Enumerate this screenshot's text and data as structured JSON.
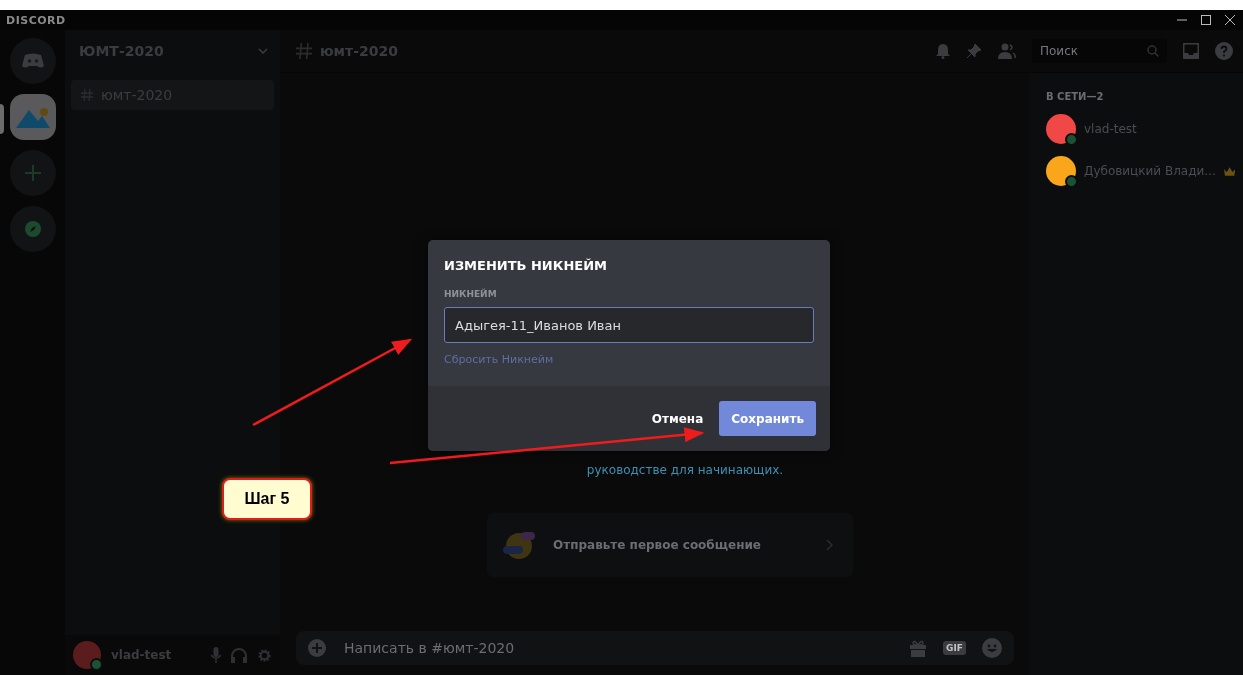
{
  "window": {
    "brand": "DISCORD"
  },
  "servers": [
    {
      "kind": "home",
      "selected": false
    },
    {
      "kind": "server",
      "selected": true
    },
    {
      "kind": "add",
      "selected": false
    },
    {
      "kind": "explore",
      "selected": false
    }
  ],
  "server": {
    "name": "ЮМТ-2020"
  },
  "channels": [
    {
      "name": "юмт-2020",
      "selected": true
    }
  ],
  "user": {
    "name": "vlad-test"
  },
  "chat": {
    "channel": "юмт-2020",
    "search_placeholder": "Поиск",
    "welcome_link": "руководстве для начинающих.",
    "first_message": "Отправьте первое сообщение",
    "composer_placeholder": "Написать в #юмт-2020",
    "gif_label": "GIF"
  },
  "members": {
    "heading": "В СЕТИ—2",
    "list": [
      {
        "name": "vlad-test",
        "color": "#f04747",
        "owner": false
      },
      {
        "name": "Дубовицкий Влади...",
        "color": "#faa61a",
        "owner": true
      }
    ]
  },
  "dialog": {
    "title": "ИЗМЕНИТЬ НИКНЕЙМ",
    "field_label": "НИКНЕЙМ",
    "value": "Адыгея-11_Иванов Иван",
    "reset_link": "Сбросить Никнейм",
    "buttons": [
      {
        "label": "Отмена",
        "kind": "link"
      },
      {
        "label": "Сохранить",
        "kind": "primary"
      }
    ]
  },
  "annotation": {
    "label": "Шаг 5"
  }
}
